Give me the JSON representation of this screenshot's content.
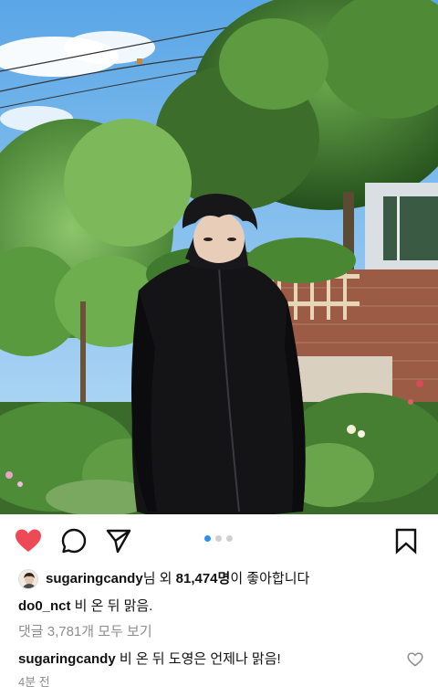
{
  "post": {
    "liked": true,
    "carousel": {
      "count": 3,
      "active_index": 0
    },
    "likes": {
      "user": "sugaringcandy",
      "middle": "님 외 ",
      "count": "81,474명",
      "suffix": "이 좋아합니다"
    },
    "caption": {
      "author": "do0_nct",
      "text": " 비 온 뒤 맑음."
    },
    "view_comments": "댓글 3,781개 모두 보기",
    "comment": {
      "author": "sugaringcandy",
      "text": " 비 온 뒤 도영은 언제나 맑음!"
    },
    "timestamp": "4분 전"
  },
  "icons": {
    "like": "heart-filled-icon",
    "comment": "comment-bubble-icon",
    "share": "paper-plane-icon",
    "save": "bookmark-icon",
    "comment_like": "heart-outline-icon"
  },
  "colors": {
    "like_red": "#ed4956",
    "carousel_active": "#2f8ef2",
    "muted_text": "#8e8e8e"
  }
}
